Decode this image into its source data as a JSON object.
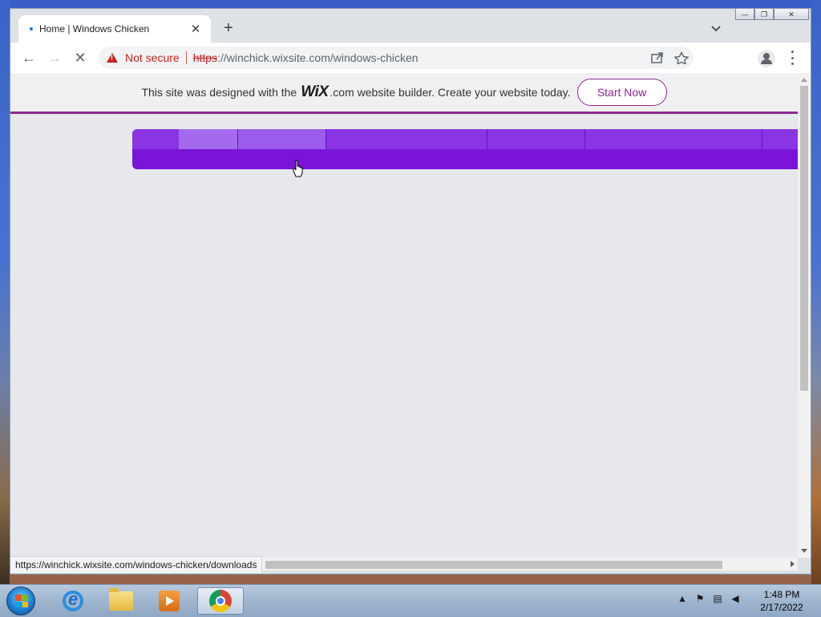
{
  "browser": {
    "tab": {
      "title": "Home | Windows Chicken",
      "close_glyph": "✕"
    },
    "new_tab_glyph": "+",
    "window_controls": {
      "minimize": "—",
      "restore": "❐",
      "close": "✕"
    },
    "toolbar": {
      "back_glyph": "←",
      "forward_glyph": "→",
      "stop_glyph": "✕",
      "security_label": "Not secure",
      "url_scheme": "https",
      "url_rest": "://winchick.wixsite.com/windows-chicken"
    },
    "status_url": "https://winchick.wixsite.com/windows-chicken/downloads"
  },
  "page": {
    "wix_banner": {
      "prefix": "This site was designed with the",
      "logo": "WiX",
      "suffix": ".com website builder. Create your website today.",
      "cta": "Start Now"
    },
    "menu_colors": {
      "bar": "#7a14d8",
      "top": "#8a34e4",
      "highlight": "#a36aee"
    }
  },
  "taskbar": {
    "apps": [
      {
        "name": "internet-explorer-icon"
      },
      {
        "name": "file-explorer-icon"
      },
      {
        "name": "media-player-icon"
      },
      {
        "name": "chrome-icon",
        "active": true
      }
    ],
    "clock": {
      "time": "1:48 PM",
      "date": "2/17/2022"
    }
  }
}
